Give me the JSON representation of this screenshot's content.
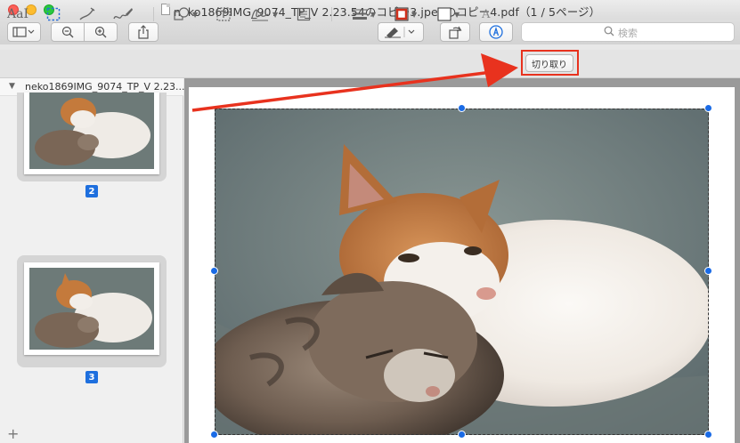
{
  "window": {
    "title": "neko1869IMG_9074_TP_V 2.23.54のコピー3.jpegのコピー4.pdf（1 / 5ページ）"
  },
  "toolbar": {
    "search_placeholder": "検索"
  },
  "markup": {
    "text_tool_label": "AaI",
    "crop_label": "切り取り"
  },
  "sidebar": {
    "document_name": "neko1869IMG_9074_TP_V 2.23....",
    "pages": [
      {
        "number": "2"
      },
      {
        "number": "3"
      }
    ],
    "add_label": "+"
  },
  "colors": {
    "accent": "#1e6fde",
    "highlight": "#e8321e",
    "border_color_swatch": "#d0301c"
  }
}
